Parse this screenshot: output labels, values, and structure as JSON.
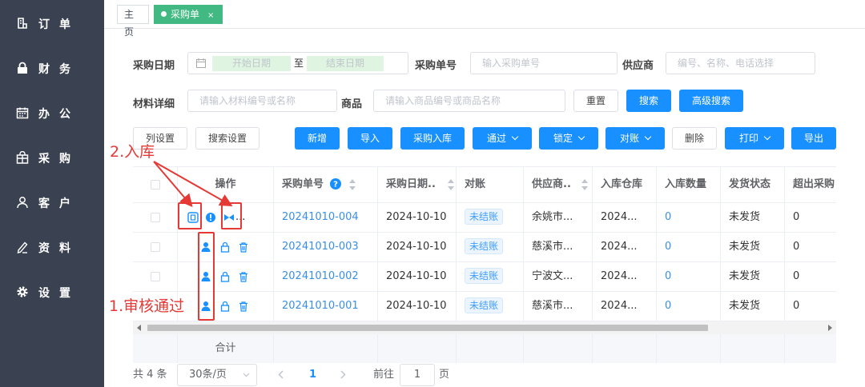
{
  "sidebar": {
    "items": [
      {
        "label": "订单",
        "icon": "order-icon"
      },
      {
        "label": "财务",
        "icon": "lock-icon"
      },
      {
        "label": "办公",
        "icon": "calendar-icon"
      },
      {
        "label": "采购",
        "icon": "bag-icon"
      },
      {
        "label": "客户",
        "icon": "user-icon"
      },
      {
        "label": "资料",
        "icon": "edit-icon"
      },
      {
        "label": "设置",
        "icon": "gear-icon"
      }
    ]
  },
  "tabs": {
    "home": "主页",
    "active": "采购单",
    "close": "×"
  },
  "filters": {
    "date_label": "采购日期",
    "start_placeholder": "开始日期",
    "to": "至",
    "end_placeholder": "结束日期",
    "order_no_label": "采购单号",
    "order_no_placeholder": "输入采购单号",
    "supplier_label": "供应商",
    "supplier_placeholder": "编号、名称、电话选择",
    "material_label": "材料详细",
    "material_placeholder": "请输入材料编号或名称",
    "goods_label": "商品",
    "goods_placeholder": "请输入商品编号或商品名称",
    "reset": "重置",
    "search": "搜索",
    "advanced": "高级搜索"
  },
  "toolbar": {
    "column_settings": "列设置",
    "search_settings": "搜索设置",
    "add": "新增",
    "import": "导入",
    "stock_in": "采购入库",
    "approve": "通过",
    "lock": "锁定",
    "reconcile": "对账",
    "delete": "删除",
    "print": "打印",
    "export": "导出"
  },
  "table": {
    "headers": [
      "操作",
      "采购单号",
      "采购日期..",
      "对账",
      "供应商..",
      "入库仓库",
      "入库数量",
      "发货状态",
      "超出采购"
    ],
    "rows": [
      {
        "order_no": "20241010-004",
        "date": "2024-10-10",
        "status": "未结账",
        "supplier": "余姚市...",
        "warehouse": "2024...",
        "qty": "0",
        "ship": "未发货",
        "over": "0",
        "ellipsis": "..."
      },
      {
        "order_no": "20241010-003",
        "date": "2024-10-10",
        "status": "未结账",
        "supplier": "慈溪市...",
        "warehouse": "2024...",
        "qty": "0",
        "ship": "未发货",
        "over": "0"
      },
      {
        "order_no": "20241010-002",
        "date": "2024-10-10",
        "status": "未结账",
        "supplier": "宁波文...",
        "warehouse": "2024...",
        "qty": "0",
        "ship": "未发货",
        "over": "0"
      },
      {
        "order_no": "20241010-001",
        "date": "2024-10-10",
        "status": "未结账",
        "supplier": "慈溪市...",
        "warehouse": "2024...",
        "qty": "0",
        "ship": "未发货",
        "over": "0"
      }
    ],
    "footer": "合计"
  },
  "pagination": {
    "total": "共 4 条",
    "page_size": "30条/页",
    "current": "1",
    "goto": "前往",
    "goto_value": "1",
    "page_unit": "页"
  },
  "annotations": {
    "stock_in": "2.入库",
    "approve": "1.审核通过"
  },
  "colors": {
    "sidebar": "#3a4150",
    "primary": "#1890ff",
    "tab_active": "#42b983",
    "annotation": "#e53935"
  }
}
